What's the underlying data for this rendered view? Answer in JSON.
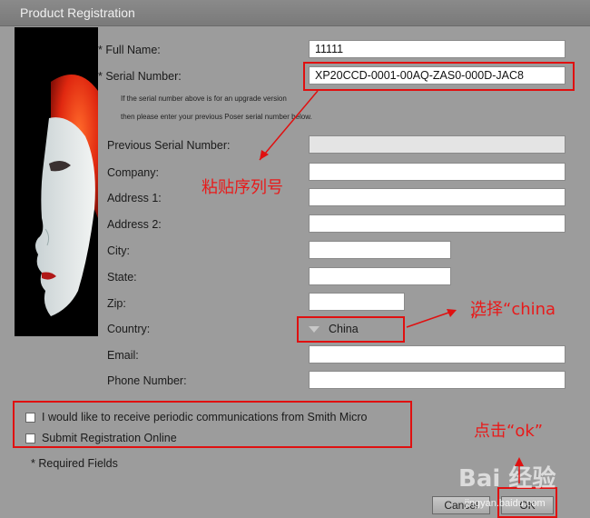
{
  "window": {
    "title": "Product Registration"
  },
  "labels": {
    "full_name": "* Full Name:",
    "serial_number": "* Serial Number:",
    "note_line1": "If the serial number above is for an upgrade version",
    "note_line2": "then please enter your previous Poser serial number below.",
    "previous_serial": "Previous Serial Number:",
    "company": "Company:",
    "address1": "Address 1:",
    "address2": "Address 2:",
    "city": "City:",
    "state": "State:",
    "zip": "Zip:",
    "country": "Country:",
    "email": "Email:",
    "phone": "Phone Number:",
    "required": "* Required Fields"
  },
  "fields": {
    "full_name": "11111",
    "serial_number": "XP20CCD-0001-00AQ-ZAS0-000D-JAC8",
    "previous_serial": "",
    "company": "",
    "address1": "",
    "address2": "",
    "city": "",
    "state": "",
    "zip": "",
    "email": "",
    "phone": ""
  },
  "country": {
    "selected": "China"
  },
  "checkboxes": {
    "communications": {
      "label": "I would like to receive periodic communications from Smith Micro",
      "checked": false
    },
    "submit_online": {
      "label": "Submit Registration Online",
      "checked": false
    }
  },
  "buttons": {
    "cancel": "Cancel",
    "ok": "OK"
  },
  "annotations": {
    "paste_serial": "粘贴序列号",
    "select_china_line1": "选择“china",
    "select_china_line2": "”",
    "click_ok": "点击“ok”"
  },
  "watermark": {
    "brand": "Bai 经验",
    "url": "jingyan.baidu.com"
  },
  "colors": {
    "annotation_red": "#e01010",
    "dialog_bg": "#9c9c9c"
  }
}
